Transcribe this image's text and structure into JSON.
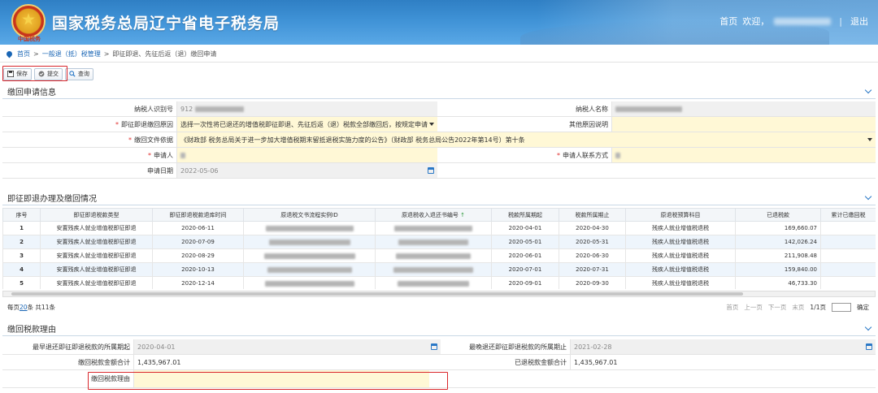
{
  "header": {
    "emblem_text": "中国税务",
    "title": "国家税务总局辽宁省电子税务局",
    "home": "首页",
    "welcome": "欢迎，",
    "logout": "退出",
    "sep": "|"
  },
  "breadcrumb": {
    "home": "首页",
    "level1": "一般退（抵）税管理",
    "current": "即征即退、先征后返（退）缴回申请",
    "sep": ">"
  },
  "toolbar": {
    "save": "保存",
    "submit": "提交",
    "query": "查询"
  },
  "sections": {
    "apply_info": "缴回申请信息",
    "situation": "即征即退办理及缴回情况",
    "reason": "缴回税款理由"
  },
  "apply_form": {
    "taxpayer_id_label": "纳税人识别号",
    "taxpayer_id_value": "912",
    "taxpayer_name_label": "纳税人名称",
    "reason_label": "即征即退缴回原因",
    "reason_value": "选择一次性将已退还的增值税即征即退、先征后返（退）税款全部缴回后，按规定申请",
    "other_reason_label": "其他原因说明",
    "doc_basis_label": "缴回文件依据",
    "doc_basis_value": "《财政部 税务总局关于进一步加大增值税期末留抵退税实施力度的公告》（财政部 税务总局公告2022年第14号）第十条",
    "applicant_label": "申请人",
    "contact_label": "申请人联系方式",
    "apply_date_label": "申请日期",
    "apply_date_value": "2022-05-06"
  },
  "table": {
    "headers": [
      "序号",
      "即征即退税款类型",
      "即征即退税款退库时间",
      "原退税文书流程实例ID",
      "原退税收入退还书编号",
      "税款所属期起",
      "税款所属期止",
      "原退税预算科目",
      "已退税款",
      "累计已缴回税"
    ],
    "rows": [
      {
        "no": "1",
        "type": "安置残疾人就业增值税即征即退",
        "time": "2020-06-11",
        "start": "2020-04-01",
        "end": "2020-04-30",
        "subject": "残疾人就业增值税退税",
        "amount": "169,660.07"
      },
      {
        "no": "2",
        "type": "安置残疾人就业增值税即征即退",
        "time": "2020-07-09",
        "start": "2020-05-01",
        "end": "2020-05-31",
        "subject": "残疾人就业增值税退税",
        "amount": "142,026.24"
      },
      {
        "no": "3",
        "type": "安置残疾人就业增值税即征即退",
        "time": "2020-08-29",
        "start": "2020-06-01",
        "end": "2020-06-30",
        "subject": "残疾人就业增值税退税",
        "amount": "211,908.48"
      },
      {
        "no": "4",
        "type": "安置残疾人就业增值税即征即退",
        "time": "2020-10-13",
        "start": "2020-07-01",
        "end": "2020-07-31",
        "subject": "残疾人就业增值税退税",
        "amount": "159,840.00"
      },
      {
        "no": "5",
        "type": "安置残疾人就业增值税即征即退",
        "time": "2020-12-14",
        "start": "2020-09-01",
        "end": "2020-09-30",
        "subject": "残疾人就业增值税退税",
        "amount": "46,733.30"
      }
    ]
  },
  "pager": {
    "per_page_prefix": "每页",
    "per_page": "20",
    "per_page_suffix": "条 共11条",
    "first": "首页",
    "prev": "上一页",
    "next": "下一页",
    "last": "末页",
    "page": "1/1页",
    "go": "确定"
  },
  "reason_form": {
    "earliest_label": "最早退还即征即退税款的所属期起",
    "earliest_value": "2020-04-01",
    "latest_label": "最晚退还即征即退税款的所属期止",
    "latest_value": "2021-02-28",
    "repay_total_label": "缴回税款金额合计",
    "repay_total_value": "1,435,967.01",
    "refunded_total_label": "已退税款金额合计",
    "refunded_total_value": "1,435,967.01",
    "reason_label": "缴回税款理由"
  }
}
